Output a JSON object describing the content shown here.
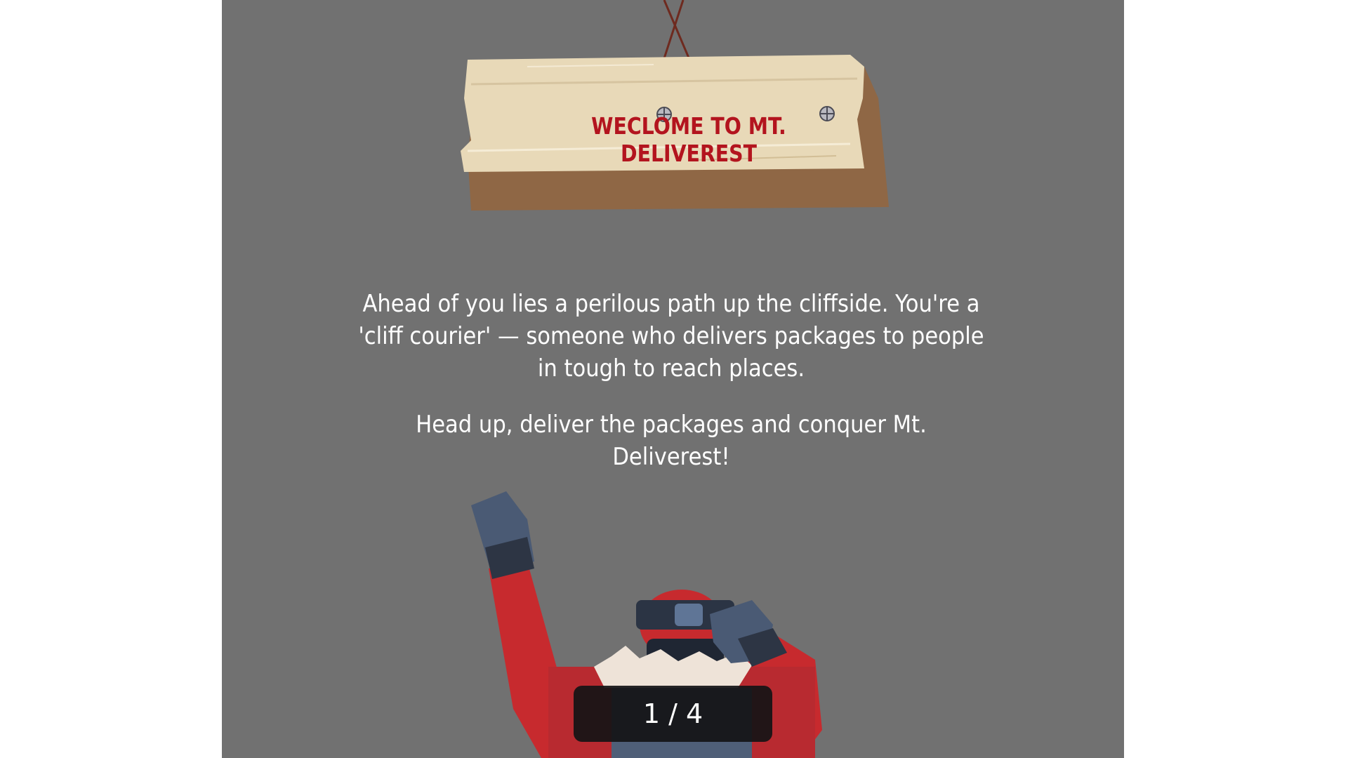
{
  "sign": {
    "title": "WECLOME TO MT. DELIVEREST",
    "title_color": "#b3141e",
    "wood_color": "#e6d7b6",
    "rope_color": "#6e2a1f"
  },
  "intro": {
    "paragraph_1": "Ahead of you lies a perilous path up the cliffside. You're a 'cliff courier' — someone who delivers packages to people in tough to reach places.",
    "paragraph_2": "Head up, deliver the packages and conquer Mt. Deliverest!"
  },
  "pager": {
    "label": "1 / 4",
    "current": 1,
    "total": 4
  },
  "theme": {
    "panel_bg": "#717171",
    "page_bg": "#ffffff",
    "jacket": "#c72a2e",
    "gloves": "#3f4b5e"
  },
  "character": {
    "icon": "climber-character"
  }
}
